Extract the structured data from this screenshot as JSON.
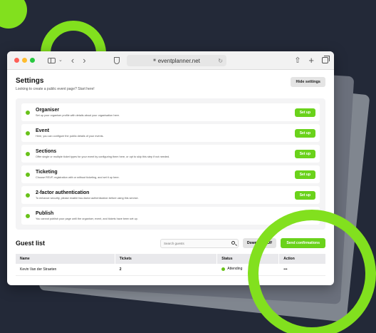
{
  "browser": {
    "url": "eventplanner.net"
  },
  "settings": {
    "title": "Settings",
    "subtitle": "Looking to create a public event page? Start here!",
    "hide_label": "Hide settings",
    "items": [
      {
        "title": "Organiser",
        "desc": "Set up your organiser profile with details about your organisation here.",
        "button": "Set up"
      },
      {
        "title": "Event",
        "desc": "Here, you can configure the public details of your events.",
        "button": "Set up"
      },
      {
        "title": "Sections",
        "desc": "Offer single or multiple ticket types for your event by configuring them here, or opt to skip this step if not needed.",
        "button": "Set up"
      },
      {
        "title": "Ticketing",
        "desc": "Choose RSVP, registration with or without ticketing, and set it up here.",
        "button": "Set up"
      },
      {
        "title": "2-factor authentication",
        "desc": "To enhance security, please enable two-factor authentication before using this service.",
        "button": "Set up"
      },
      {
        "title": "Publish",
        "desc": "You cannot publish your page until the organiser, event, and tickets have been set up.",
        "button": ""
      }
    ]
  },
  "guests": {
    "title": "Guest list",
    "search_placeholder": "Search guests",
    "pdf_label": "Download PDF",
    "send_label": "Send confirmations",
    "columns": [
      "Name",
      "Tickets",
      "Status",
      "Action"
    ],
    "rows": [
      {
        "name": "Kevin Van der Straeten",
        "tickets": "2",
        "status": "Attending",
        "action": "•••"
      }
    ]
  },
  "colors": {
    "accent": "#6ad21b",
    "background": "#232938"
  }
}
